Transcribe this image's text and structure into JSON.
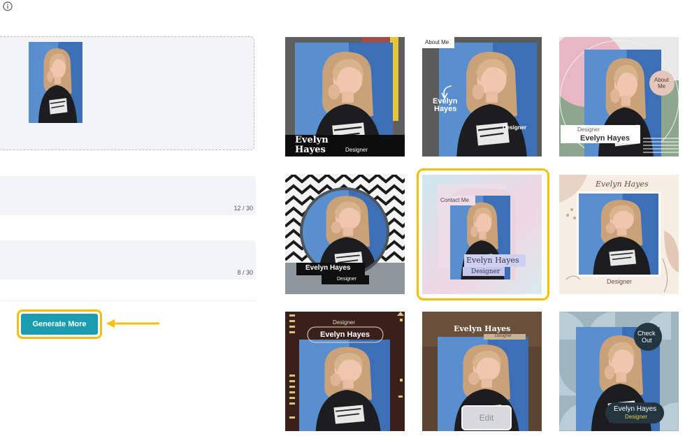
{
  "header": {
    "info_icon": "info-icon"
  },
  "form": {
    "field1_counter": "12 / 30",
    "field2_counter": "8 / 30",
    "generate_label": "Generate More"
  },
  "templates": {
    "t1": {
      "name_line1": "Evelyn",
      "name_line2": "Hayes",
      "role": "Designer"
    },
    "t2": {
      "tag": "About Me",
      "name_line1": "Evelyn",
      "name_line2": "Hayes",
      "role": "Designer"
    },
    "t3": {
      "badge_line1": "About",
      "badge_line2": "Me",
      "role": "Designer",
      "name": "Evelyn Hayes"
    },
    "t4": {
      "name": "Evelyn Hayes",
      "role": "Designer"
    },
    "t5": {
      "tag": "Contact Me",
      "name": "Evelyn Hayes",
      "role": "Designer"
    },
    "t6": {
      "name": "Evelyn Hayes",
      "role": "Designer"
    },
    "t7": {
      "role": "Designer",
      "name": "Evelyn Hayes"
    },
    "t8": {
      "name": "Evelyn Hayes",
      "role": "Designer",
      "edit_label": "Edit"
    },
    "t9": {
      "badge_line1": "Check",
      "badge_line2": "Out",
      "name": "Evelyn Hayes",
      "role": "Designer"
    }
  },
  "colors": {
    "accent_highlight": "#f5c000",
    "primary_button": "#1a9db0"
  }
}
